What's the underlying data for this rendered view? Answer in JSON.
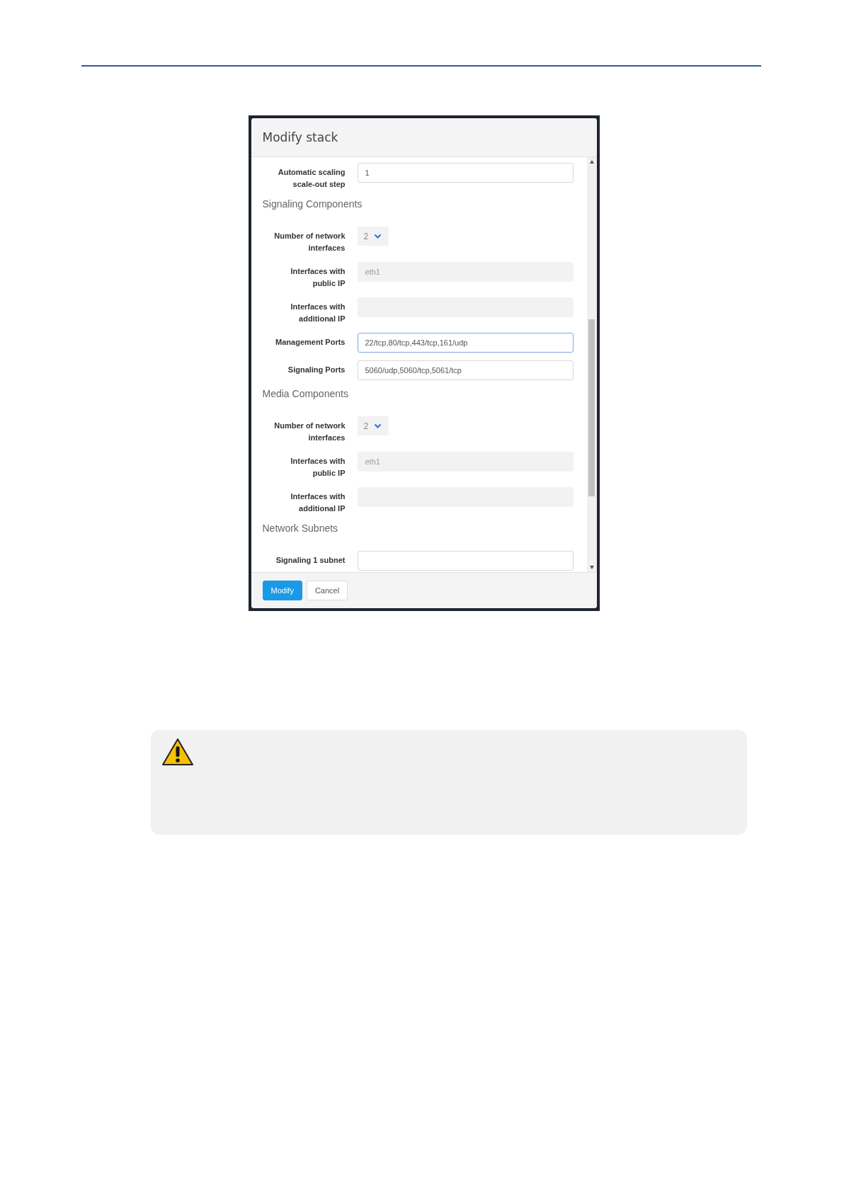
{
  "dialog": {
    "title": "Modify stack",
    "fields": [
      {
        "kind": "input",
        "label": "Automatic scaling scale-out step",
        "value": "1",
        "focused": false
      },
      {
        "kind": "section",
        "label": "Signaling Components"
      },
      {
        "kind": "select",
        "label": "Number of network interfaces",
        "value": "2"
      },
      {
        "kind": "readonly",
        "label": "Interfaces with public IP",
        "value": "eth1"
      },
      {
        "kind": "readonly",
        "label": "Interfaces with additional IP"
      },
      {
        "kind": "input",
        "label": "Management Ports",
        "value": "22/tcp,80/tcp,443/tcp,161/udp",
        "focused": true
      },
      {
        "kind": "input",
        "label": "Signaling Ports",
        "value": "5060/udp,5060/tcp,5061/tcp",
        "focused": false
      },
      {
        "kind": "section",
        "label": "Media Components"
      },
      {
        "kind": "select",
        "label": "Number of network interfaces",
        "value": "2"
      },
      {
        "kind": "readonly",
        "label": "Interfaces with public IP",
        "value": "eth1"
      },
      {
        "kind": "readonly",
        "label": "Interfaces with additional IP"
      },
      {
        "kind": "section",
        "label": "Network Subnets"
      },
      {
        "kind": "input",
        "label": "Signaling 1 subnet",
        "focused": false
      }
    ],
    "buttons": [
      {
        "label": "Modify",
        "primary": true
      },
      {
        "label": "Cancel",
        "primary": false
      }
    ]
  }
}
